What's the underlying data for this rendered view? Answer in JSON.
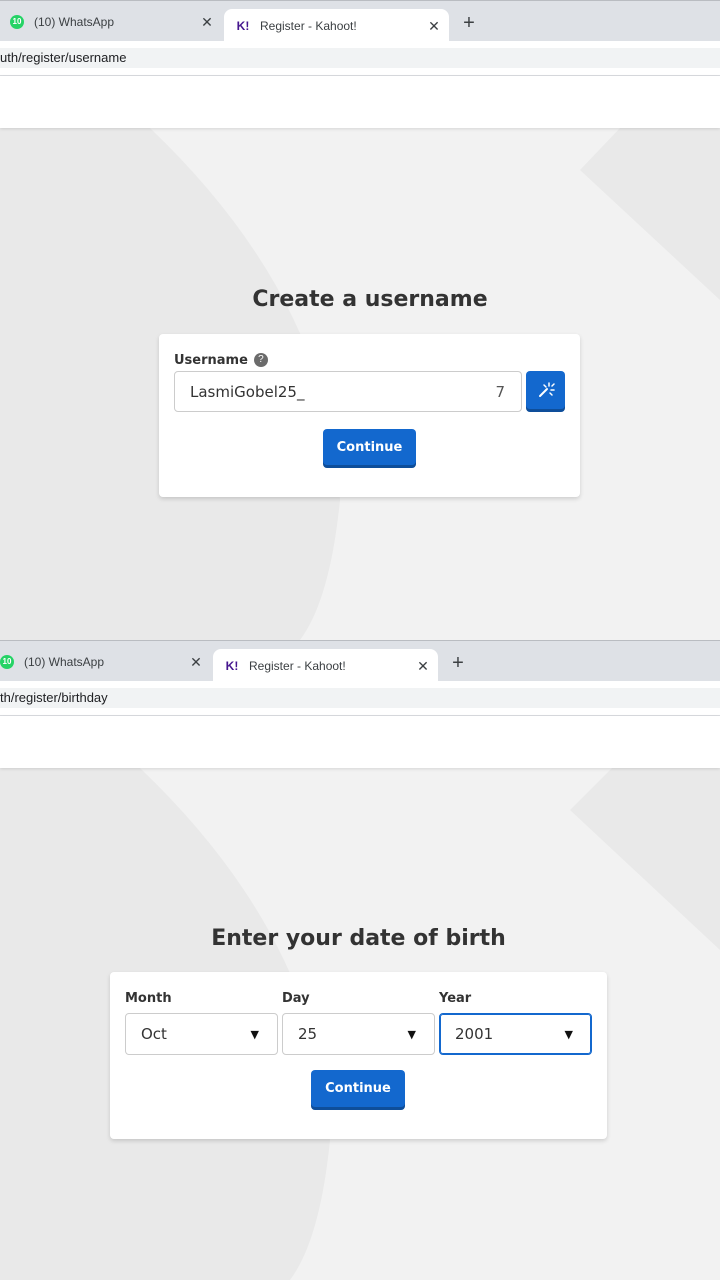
{
  "shot1": {
    "tabs": [
      {
        "title": "(10) WhatsApp",
        "badge": "10",
        "icon": "whatsapp-icon"
      },
      {
        "title": "Register - Kahoot!",
        "icon": "kahoot-icon",
        "icon_text": "K!"
      }
    ],
    "url": "uth/register/username",
    "heading": "Create a username",
    "username_label": "Username",
    "username_value": "LasmiGobel25_",
    "char_count": "7",
    "continue_label": "Continue"
  },
  "shot2": {
    "tabs": [
      {
        "title": "(10) WhatsApp",
        "badge": "10",
        "icon": "whatsapp-icon"
      },
      {
        "title": "Register - Kahoot!",
        "icon": "kahoot-icon",
        "icon_text": "K!"
      }
    ],
    "url": "th/register/birthday",
    "heading": "Enter your date of birth",
    "month_label": "Month",
    "month_value": "Oct",
    "day_label": "Day",
    "day_value": "25",
    "year_label": "Year",
    "year_value": "2001",
    "continue_label": "Continue"
  },
  "colors": {
    "accent": "#1368ce",
    "background": "#f2f2f2",
    "whatsapp": "#25d366",
    "kahoot": "#46178f"
  }
}
